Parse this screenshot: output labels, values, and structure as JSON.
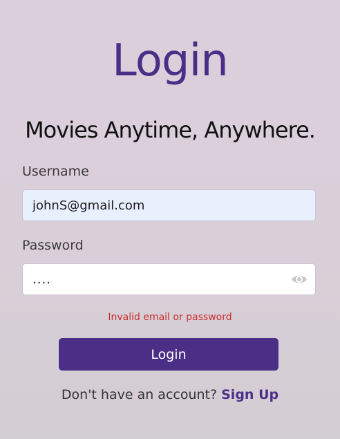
{
  "header": {
    "title": "Login",
    "tagline": "Movies Anytime, Anywhere."
  },
  "form": {
    "username_label": "Username",
    "username_value": "johnS@gmail.com",
    "password_label": "Password",
    "password_value": "....",
    "password_toggle_icon": "eye-icon",
    "error_message": "Invalid email or password",
    "submit_label": "Login"
  },
  "footer": {
    "prompt": "Don't have an account?",
    "signup_label": "Sign Up"
  },
  "colors": {
    "accent": "#4b2f87",
    "error": "#cc2b2b",
    "autofill_bg": "#e8f0fe"
  }
}
